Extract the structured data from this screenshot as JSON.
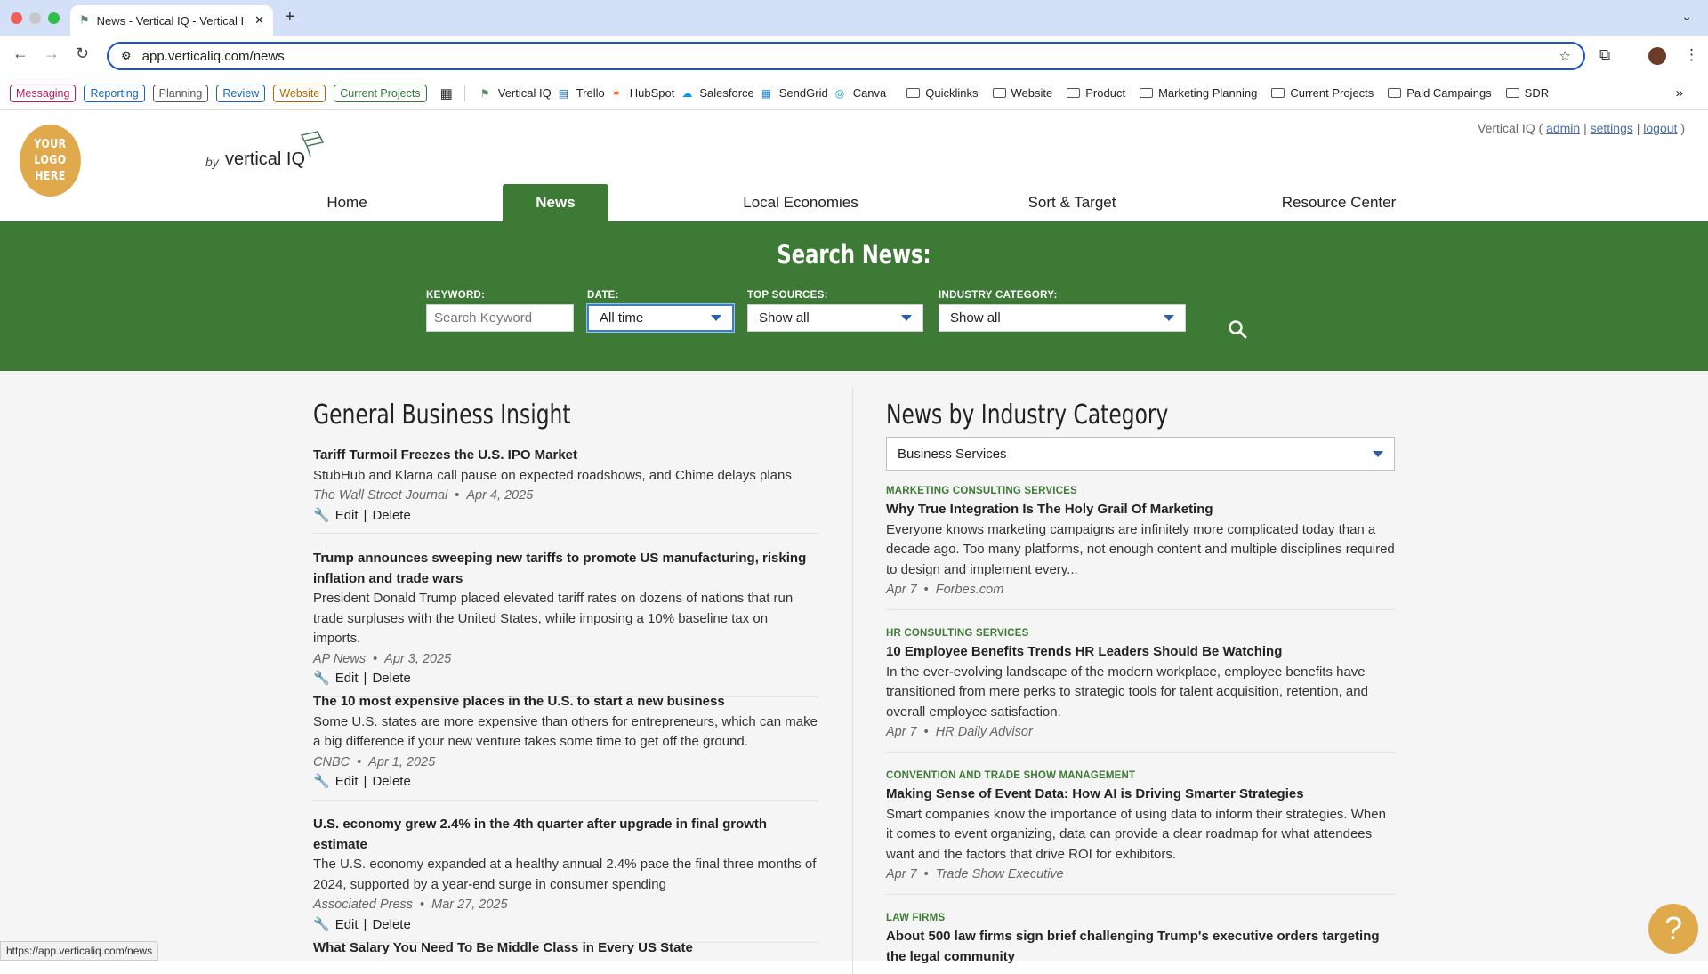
{
  "browser": {
    "tab_title": "News - Vertical IQ - Vertical I",
    "url": "app.verticaliq.com/news",
    "status_url": "https://app.verticaliq.com/news",
    "bookmark_chips": [
      {
        "label": "Messaging",
        "color": "#c2185b"
      },
      {
        "label": "Reporting",
        "color": "#1565c0"
      },
      {
        "label": "Planning",
        "color": "#555555"
      },
      {
        "label": "Review",
        "color": "#1565c0"
      },
      {
        "label": "Website",
        "color": "#b26a00"
      },
      {
        "label": "Current Projects",
        "color": "#2e7d32"
      }
    ],
    "bookmarks": [
      "Vertical IQ",
      "Trello",
      "HubSpot",
      "Salesforce",
      "SendGrid",
      "Canva"
    ],
    "folders": [
      "Quicklinks",
      "Website",
      "Product",
      "Marketing Planning",
      "Current Projects",
      "Paid Campaings",
      "SDR"
    ]
  },
  "site": {
    "logo_text": "YOUR LOGO HERE",
    "by": "by",
    "brand": "vertical IQ",
    "account_prefix": "Vertical IQ (",
    "account_links": [
      "admin",
      "settings",
      "logout"
    ],
    "account_suffix": ")",
    "nav": [
      "Home",
      "News",
      "Local Economies",
      "Sort & Target",
      "Resource Center"
    ],
    "active_nav": "News",
    "brand_green": "#3d7a35",
    "accent_gold": "#e0a94c"
  },
  "search": {
    "title": "Search News:",
    "keyword_label": "KEYWORD:",
    "keyword_placeholder": "Search Keyword",
    "date_label": "DATE:",
    "date_value": "All time",
    "sources_label": "TOP SOURCES:",
    "sources_value": "Show all",
    "category_label": "INDUSTRY CATEGORY:",
    "category_value": "Show all"
  },
  "general": {
    "title": "General Business Insight",
    "edit_label": "Edit",
    "delete_label": "Delete",
    "articles": [
      {
        "title": "Tariff Turmoil Freezes the U.S. IPO Market",
        "desc": "StubHub and Klarna call pause on expected roadshows, and Chime delays plans",
        "source": "The Wall Street Journal",
        "date": "Apr 4, 2025"
      },
      {
        "title": "Trump announces sweeping new tariffs to promote US manufacturing, risking inflation and trade wars",
        "desc": "President Donald Trump placed elevated tariff rates on dozens of nations that run trade surpluses with the United States, while imposing a 10% baseline tax on imports.",
        "source": "AP News",
        "date": "Apr 3, 2025"
      },
      {
        "title": "The 10 most expensive places in the U.S. to start a new business",
        "desc": "Some U.S. states are more expensive than others for entrepreneurs, which can make a big difference if your new venture takes some time to get off the ground.",
        "source": "CNBC",
        "date": "Apr 1, 2025"
      },
      {
        "title": "U.S. economy grew 2.4% in the 4th quarter after upgrade in final growth estimate",
        "desc": "The U.S. economy expanded at a healthy annual 2.4% pace the final three months of 2024, supported by a year-end surge in consumer spending",
        "source": "Associated Press",
        "date": "Mar 27, 2025"
      },
      {
        "title": "What Salary You Need To Be Middle Class in Every US State",
        "desc": "",
        "source": "",
        "date": ""
      }
    ]
  },
  "industry": {
    "title": "News by Industry Category",
    "selected": "Business Services",
    "articles": [
      {
        "category": "MARKETING CONSULTING SERVICES",
        "title": "Why True Integration Is The Holy Grail Of Marketing",
        "desc": "Everyone knows marketing campaigns are infinitely more complicated today than a decade ago. Too many platforms, not enough content and multiple disciplines required to design and implement every...",
        "date": "Apr 7",
        "source": "Forbes.com"
      },
      {
        "category": "HR CONSULTING SERVICES",
        "title": "10 Employee Benefits Trends HR Leaders Should Be Watching",
        "desc": "In the ever-evolving landscape of the modern workplace, employee benefits have transitioned from mere perks to strategic tools for talent acquisition, retention, and overall employee satisfaction.",
        "date": "Apr 7",
        "source": "HR Daily Advisor"
      },
      {
        "category": "CONVENTION AND TRADE SHOW MANAGEMENT",
        "title": "Making Sense of Event Data: How AI is Driving Smarter Strategies",
        "desc": "Smart companies know the importance of using data to inform their strategies. When it comes to event organizing, data can provide a clear roadmap for what attendees want and the factors that drive ROI for exhibitors.",
        "date": "Apr 7",
        "source": "Trade Show Executive"
      },
      {
        "category": "LAW FIRMS",
        "title": "About 500 law firms sign brief challenging Trump's executive orders targeting the legal community",
        "desc": "",
        "date": "",
        "source": ""
      }
    ]
  },
  "help": {
    "label": "?"
  }
}
